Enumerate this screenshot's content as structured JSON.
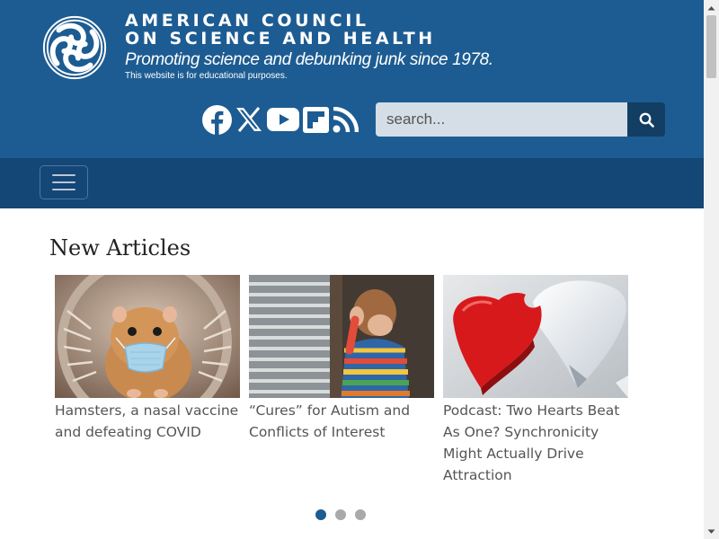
{
  "header": {
    "site_name_line1": "AMERICAN COUNCIL",
    "site_name_line2": "ON SCIENCE AND HEALTH",
    "tagline": "Promoting science and debunking junk since 1978.",
    "disclaimer": "This website is for educational purposes."
  },
  "social": [
    {
      "name": "facebook-icon"
    },
    {
      "name": "x-icon"
    },
    {
      "name": "youtube-icon"
    },
    {
      "name": "flipboard-icon"
    },
    {
      "name": "rss-icon"
    }
  ],
  "search": {
    "placeholder": "search...",
    "button_icon": "search-icon"
  },
  "navbar": {
    "toggle_icon": "hamburger-menu-icon"
  },
  "main": {
    "section_title": "New Articles",
    "articles": [
      {
        "title": "Hamsters, a nasal vaccine and defeating COVID"
      },
      {
        "title": "“Cures” for Autism and Conflicts of Interest"
      },
      {
        "title": "Podcast: Two Hearts Beat As One? Synchronicity Might Actually Drive Attraction"
      }
    ],
    "carousel_pages": 3,
    "carousel_active": 1
  },
  "colors": {
    "brand": "#1d5c92",
    "navbar": "#144676",
    "search_button": "#123e64"
  }
}
